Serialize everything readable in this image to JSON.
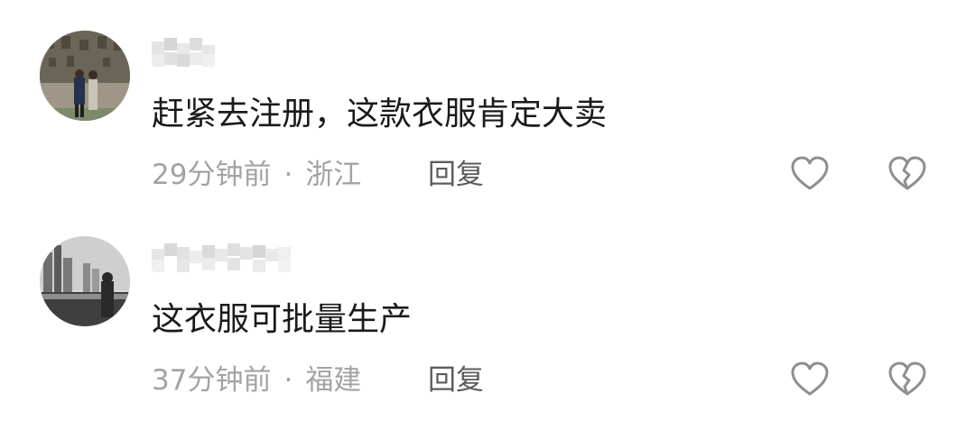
{
  "comments": [
    {
      "content": "赶紧去注册，这款衣服肯定大卖",
      "time": "29分钟前",
      "separator": "·",
      "location": "浙江",
      "reply_label": "回复",
      "like_icon": "heart-outline-icon",
      "dislike_icon": "broken-heart-icon"
    },
    {
      "content": "这衣服可批量生产",
      "time": "37分钟前",
      "separator": "·",
      "location": "福建",
      "reply_label": "回复",
      "like_icon": "heart-outline-icon",
      "dislike_icon": "broken-heart-icon"
    }
  ],
  "colors": {
    "text_primary": "#1a1a1a",
    "text_meta": "#a3a3a3",
    "text_reply": "#5c5c5c",
    "icon": "#8f8f8f"
  }
}
